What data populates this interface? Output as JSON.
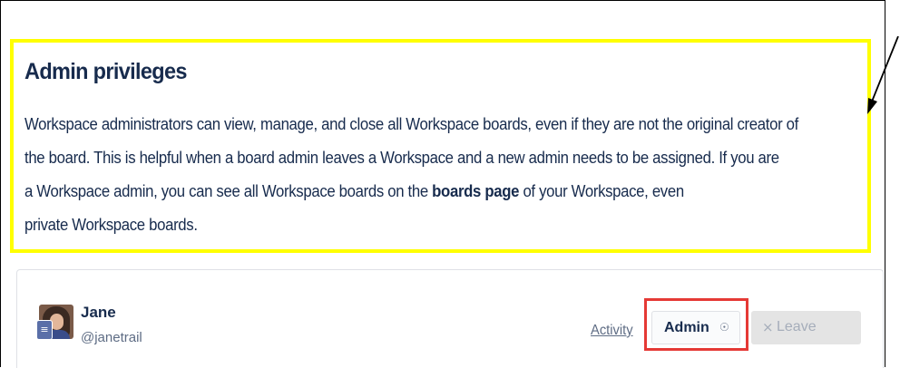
{
  "section": {
    "title": "Admin privileges",
    "paragraph_lines": {
      "line1": "Workspace administrators can view, manage, and close all Workspace boards, even if they are not the original creator of",
      "line2": "the board. This is helpful when a board admin leaves a Workspace and a new admin needs to be assigned. If you are",
      "line3_before": "a Workspace admin, you can see all Workspace boards on the ",
      "line3_bold": "boards page",
      "line3_after": " of your Workspace, even",
      "line4": "private Workspace boards."
    }
  },
  "member": {
    "name": "Jane",
    "handle": "@janetrail",
    "avatar_icon": "user-avatar-photo",
    "badge_icon": "workspace-admin-badge-icon",
    "activity_label": "Activity",
    "role_label": "Admin",
    "role_dropdown_icon": "circle-chevron-down-icon",
    "leave_icon": "close-x-icon",
    "leave_label": "Leave"
  },
  "colors": {
    "callout_highlight": "#ffff00",
    "button_highlight": "#e53935",
    "text_primary": "#172b4d",
    "text_secondary": "#5e6c84",
    "disabled_button": "#e4e4e4"
  }
}
